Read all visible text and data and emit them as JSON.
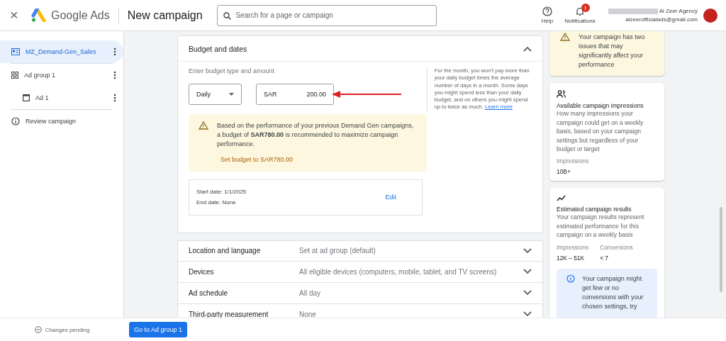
{
  "header": {
    "close": "×",
    "product": "Google Ads",
    "title": "New campaign",
    "search": {
      "placeholder": "Search for a page or campaign"
    },
    "help": "Help",
    "notifications": {
      "label": "Notifications",
      "badge": "!"
    },
    "account": {
      "name": "Al Zeer Agency",
      "email": "alzeerofficialads@gmail.com"
    }
  },
  "sidebar": {
    "items": [
      {
        "kind": "campaign",
        "label": "MZ_Demand-Gen_Sales",
        "selected": true
      },
      {
        "kind": "adgroup",
        "label": "Ad group 1",
        "selected": false,
        "children": [
          {
            "kind": "ad",
            "label": "Ad 1",
            "selected": false
          }
        ]
      },
      {
        "kind": "review",
        "label": "Review campaign",
        "selected": false
      }
    ],
    "status": "Changes pending"
  },
  "budget": {
    "title": "Budget and dates",
    "expanded": true,
    "prompt": "Enter budget type and amount",
    "type": "Daily",
    "currency": "SAR",
    "amount": "200.00",
    "note": "For the month, you won't pay more than your daily budget times the average number of days in a month. Some days you might spend less than your daily budget, and on others you might spend up to twice as much.",
    "note_link": "Learn more",
    "recommendation": "Based on the performance of your previous Demand Gen campaigns, a budget of **SAR780.00** is recommended to maximize campaign performance.",
    "recommendation_action": "Set budget to SAR780.00",
    "start_date": "Start date: 1/1/2025",
    "end_date": "End date: None",
    "edit": "Edit"
  },
  "settings": [
    {
      "label": "Location and language",
      "value": "Set at ad group (default)",
      "expanded": false
    },
    {
      "label": "Devices",
      "value": "All eligible devices (computers, mobile, tablet, and TV screens)",
      "expanded": false
    },
    {
      "label": "Ad schedule",
      "value": "All day",
      "expanded": false
    },
    {
      "label": "Third-party measurement",
      "value": "None",
      "expanded": false
    }
  ],
  "primary_button": "Go to Ad group 1",
  "insights": [
    {
      "kind": "warning",
      "text": "Your campaign has two issues that may significantly affect your performance"
    },
    {
      "kind": "impressions",
      "title": "Available campaign impressions",
      "text": "How many impressions your campaign could get on a weekly basis, based on your campaign settings but regardless of your budget or target",
      "metrics": [
        {
          "label": "Impressions",
          "value": "10B+"
        }
      ]
    },
    {
      "kind": "results",
      "title": "Estimated campaign results",
      "text": "Your campaign results represent estimated performance for this campaign on a weekly basis",
      "metrics": [
        {
          "label": "Impressions",
          "value": "12K – 51K"
        },
        {
          "label": "Conversions",
          "value": "< 7"
        }
      ],
      "info": "Your campaign might get few or no conversions with your chosen settings, try"
    }
  ]
}
